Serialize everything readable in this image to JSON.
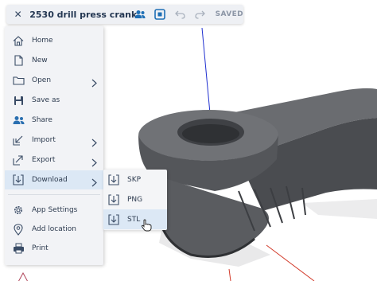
{
  "toolbar": {
    "close_icon": "close-icon",
    "title": "2530 drill press crank",
    "status": "SAVED",
    "accent": "#1e6fb5"
  },
  "menu": {
    "items": [
      {
        "label": "Home",
        "icon": "home-icon"
      },
      {
        "label": "New",
        "icon": "new-document-icon"
      },
      {
        "label": "Open",
        "icon": "folder-icon"
      },
      {
        "label": "Save as",
        "icon": "save-icon"
      },
      {
        "label": "Share",
        "icon": "share-users-icon"
      },
      {
        "label": "Import",
        "icon": "import-icon"
      },
      {
        "label": "Export",
        "icon": "export-icon"
      },
      {
        "label": "Download",
        "icon": "download-icon"
      },
      {
        "label": "App Settings",
        "icon": "settings-gear-icon"
      },
      {
        "label": "Add location",
        "icon": "location-pin-icon"
      },
      {
        "label": "Print",
        "icon": "printer-icon"
      }
    ],
    "active_item": "Download"
  },
  "submenu": {
    "items": [
      {
        "label": "SKP",
        "icon": "download-icon"
      },
      {
        "label": "PNG",
        "icon": "download-icon"
      },
      {
        "label": "STL",
        "icon": "download-icon"
      }
    ],
    "active_item": "STL"
  },
  "colors": {
    "menu_bg": "#f2f3f6",
    "highlight": "#dce8f5",
    "model_gray": "#5a5c60",
    "axis_blue": "#1f2fd0",
    "axis_red": "#d23a2a"
  }
}
